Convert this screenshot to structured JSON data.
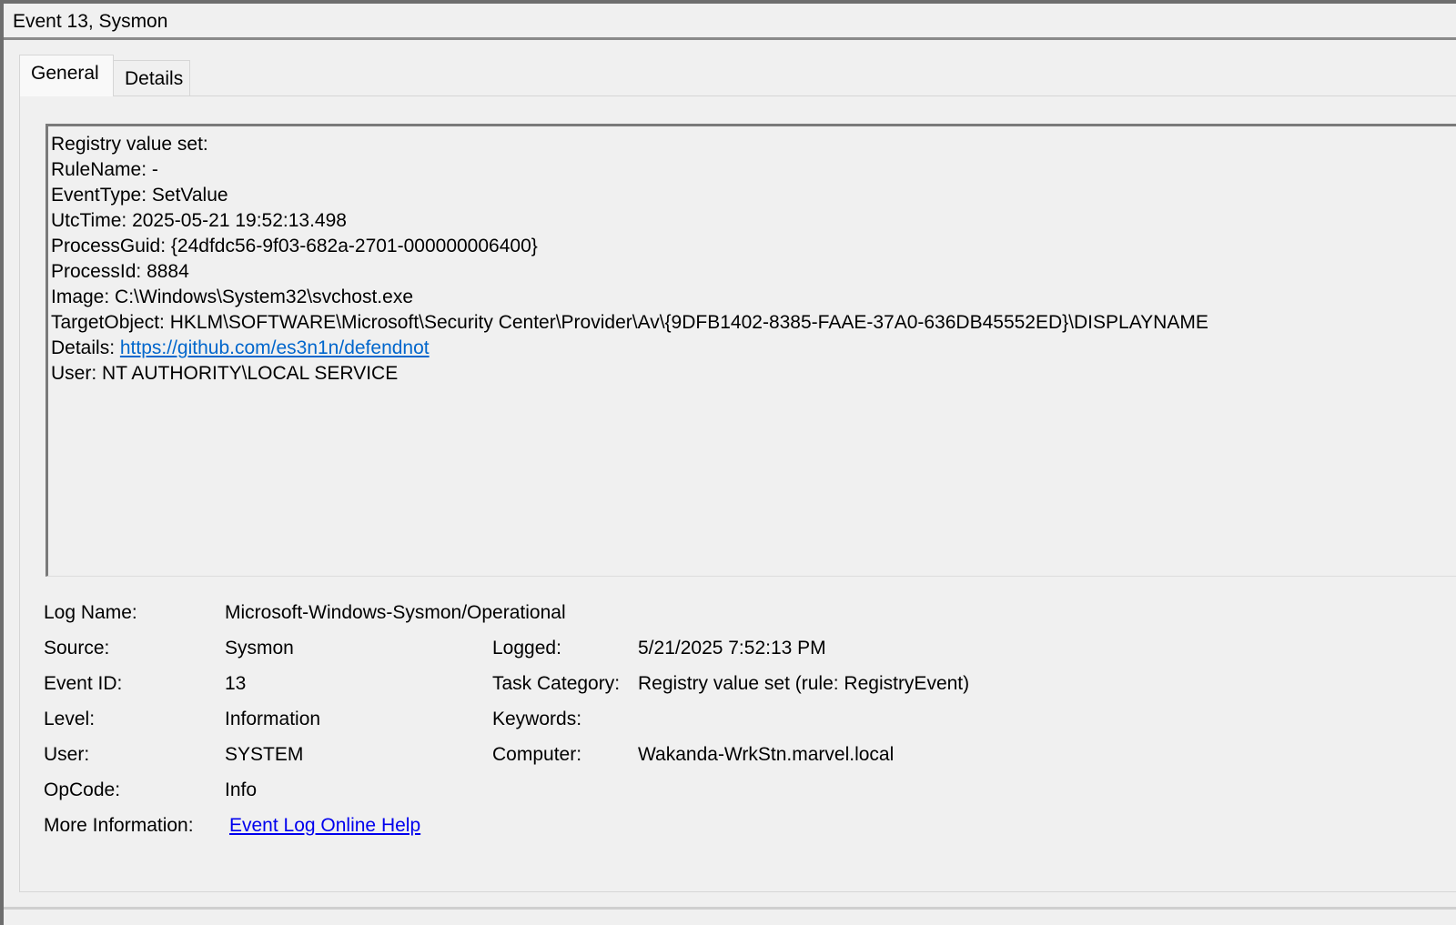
{
  "window": {
    "title": "Event 13, Sysmon"
  },
  "tabs": [
    {
      "label": "General",
      "selected": true
    },
    {
      "label": "Details",
      "selected": false
    }
  ],
  "description": {
    "lines": [
      {
        "label": "Registry value set:",
        "value": ""
      },
      {
        "label": "RuleName:",
        "value": "-"
      },
      {
        "label": "EventType:",
        "value": "SetValue"
      },
      {
        "label": "UtcTime:",
        "value": "2025-05-21 19:52:13.498"
      },
      {
        "label": "ProcessGuid:",
        "value": "{24dfdc56-9f03-682a-2701-000000006400}"
      },
      {
        "label": "ProcessId:",
        "value": "8884"
      },
      {
        "label": "Image:",
        "value": "C:\\Windows\\System32\\svchost.exe"
      },
      {
        "label": "TargetObject:",
        "value": "HKLM\\SOFTWARE\\Microsoft\\Security Center\\Provider\\Av\\{9DFB1402-8385-FAAE-37A0-636DB45552ED}\\DISPLAYNAME"
      },
      {
        "label": "Details:",
        "link": "https://github.com/es3n1n/defendnot"
      },
      {
        "label": "User:",
        "value": "NT AUTHORITY\\LOCAL SERVICE"
      }
    ]
  },
  "info": {
    "log_name_label": "Log Name:",
    "log_name_value": "Microsoft-Windows-Sysmon/Operational",
    "source_label": "Source:",
    "source_value": "Sysmon",
    "logged_label": "Logged:",
    "logged_value": "5/21/2025 7:52:13 PM",
    "event_id_label": "Event ID:",
    "event_id_value": "13",
    "task_category_label": "Task Category:",
    "task_category_value": "Registry value set (rule: RegistryEvent)",
    "level_label": "Level:",
    "level_value": "Information",
    "keywords_label": "Keywords:",
    "keywords_value": "",
    "user_label": "User:",
    "user_value": "SYSTEM",
    "computer_label": "Computer:",
    "computer_value": "Wakanda-WrkStn.marvel.local",
    "opcode_label": "OpCode:",
    "opcode_value": "Info",
    "more_info_label": "More Information:",
    "more_info_link": "Event Log Online Help"
  },
  "colors": {
    "background": "#f0f0f0",
    "link": "#0066cc",
    "help_link": "#0000ee"
  }
}
